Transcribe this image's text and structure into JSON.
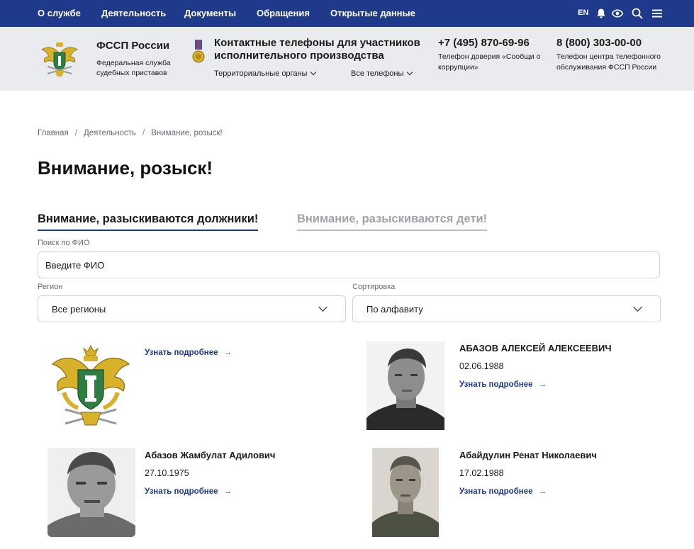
{
  "topnav": {
    "links": [
      "О службе",
      "Деятельность",
      "Документы",
      "Обращения",
      "Открытые данные"
    ],
    "lang": "EN"
  },
  "header": {
    "org_name": "ФССП России",
    "org_sub": "Федеральная служба судебных приставов",
    "contacts_title": "Контактные телефоны для участников исполнительного производства",
    "dropdown_territorial": "Территориальные органы",
    "dropdown_phones": "Все телефоны",
    "phone1": "+7 (495) 870-69-96",
    "phone1_sub": "Телефон доверия «Сообщи о коррупции»",
    "phone2": "8 (800) 303-00-00",
    "phone2_sub": "Телефон центра телефонного обслуживания ФССП России"
  },
  "breadcrumb": [
    "Главная",
    "Деятельность",
    "Внимание, розыск!"
  ],
  "page_title": "Внимание, розыск!",
  "tabs": [
    {
      "label": "Внимание, разыскиваются должники!",
      "active": true
    },
    {
      "label": "Внимание, разыскиваются дети!",
      "active": false
    }
  ],
  "search": {
    "label": "Поиск по ФИО",
    "placeholder": "Введите ФИО"
  },
  "filters": {
    "region_label": "Регион",
    "region_value": "Все регионы",
    "sort_label": "Сортировка",
    "sort_value": "По алфавиту"
  },
  "cards": [
    {
      "name": "",
      "date": "",
      "link": "Узнать подробнее"
    },
    {
      "name": "АБАЗОВ АЛЕКСЕЙ АЛЕКСЕЕВИЧ",
      "date": "02.06.1988",
      "link": "Узнать подробнее"
    },
    {
      "name": "Абазов Жамбулат Адилович",
      "date": "27.10.1975",
      "link": "Узнать подробнее"
    },
    {
      "name": "Абайдулин Ренат Николаевич",
      "date": "17.02.1988",
      "link": "Узнать подробнее"
    }
  ],
  "colors": {
    "brand_blue": "#1f3a8a",
    "header_bg": "#e9ebee",
    "gold": "#d8b12a"
  }
}
